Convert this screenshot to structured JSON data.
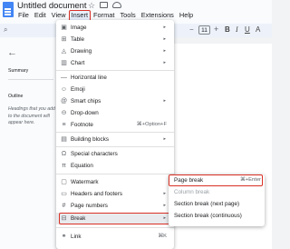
{
  "app": {
    "title": "Untitled document",
    "menus": [
      "File",
      "Edit",
      "View",
      "Insert",
      "Format",
      "Tools",
      "Extensions",
      "Help"
    ]
  },
  "toolbar": {
    "font_size": "11",
    "minus": "−",
    "plus": "+",
    "bold": "B",
    "italic": "I",
    "underline": "U",
    "text_color": "A"
  },
  "sidebar": {
    "summary_label": "Summary",
    "outline_label": "Outline",
    "outline_hint": "Headings that you add to the document will appear here."
  },
  "insert_menu": {
    "items": [
      {
        "icon": "image-icon",
        "label": "Image",
        "shortcut": "",
        "submenu": true
      },
      {
        "icon": "table-icon",
        "label": "Table",
        "shortcut": "",
        "submenu": true
      },
      {
        "icon": "drawing-icon",
        "label": "Drawing",
        "shortcut": "",
        "submenu": true
      },
      {
        "icon": "chart-icon",
        "label": "Chart",
        "shortcut": "",
        "submenu": true
      },
      {
        "icon": "horizontal-line-icon",
        "label": "Horizontal line",
        "shortcut": "",
        "submenu": false
      },
      {
        "icon": "emoji-icon",
        "label": "Emoji",
        "shortcut": "",
        "submenu": false
      },
      {
        "icon": "smart-chips-icon",
        "label": "Smart chips",
        "shortcut": "",
        "submenu": true
      },
      {
        "icon": "dropdown-icon",
        "label": "Drop-down",
        "shortcut": "",
        "submenu": false
      },
      {
        "icon": "footnote-icon",
        "label": "Footnote",
        "shortcut": "⌘+Option+F",
        "submenu": false
      },
      {
        "icon": "building-blocks-icon",
        "label": "Building blocks",
        "shortcut": "",
        "submenu": true
      },
      {
        "icon": "special-characters-icon",
        "label": "Special characters",
        "shortcut": "",
        "submenu": false
      },
      {
        "icon": "equation-icon",
        "label": "Equation",
        "shortcut": "",
        "submenu": false
      },
      {
        "icon": "watermark-icon",
        "label": "Watermark",
        "shortcut": "",
        "submenu": false
      },
      {
        "icon": "headers-footers-icon",
        "label": "Headers and footers",
        "shortcut": "",
        "submenu": true
      },
      {
        "icon": "page-numbers-icon",
        "label": "Page numbers",
        "shortcut": "",
        "submenu": true
      },
      {
        "icon": "break-icon",
        "label": "Break",
        "shortcut": "",
        "submenu": true
      },
      {
        "icon": "link-icon",
        "label": "Link",
        "shortcut": "⌘K",
        "submenu": false
      }
    ]
  },
  "break_submenu": {
    "items": [
      {
        "label": "Page break",
        "shortcut": "⌘+Enter",
        "disabled": false
      },
      {
        "label": "Column break",
        "shortcut": "",
        "disabled": true
      },
      {
        "label": "Section break (next page)",
        "shortcut": "",
        "disabled": false
      },
      {
        "label": "Section break (continuous)",
        "shortcut": "",
        "disabled": false
      }
    ]
  },
  "colors": {
    "highlight_border": "#d93025",
    "doc_icon": "#4285f4",
    "hover_row": "#e8eaed"
  }
}
